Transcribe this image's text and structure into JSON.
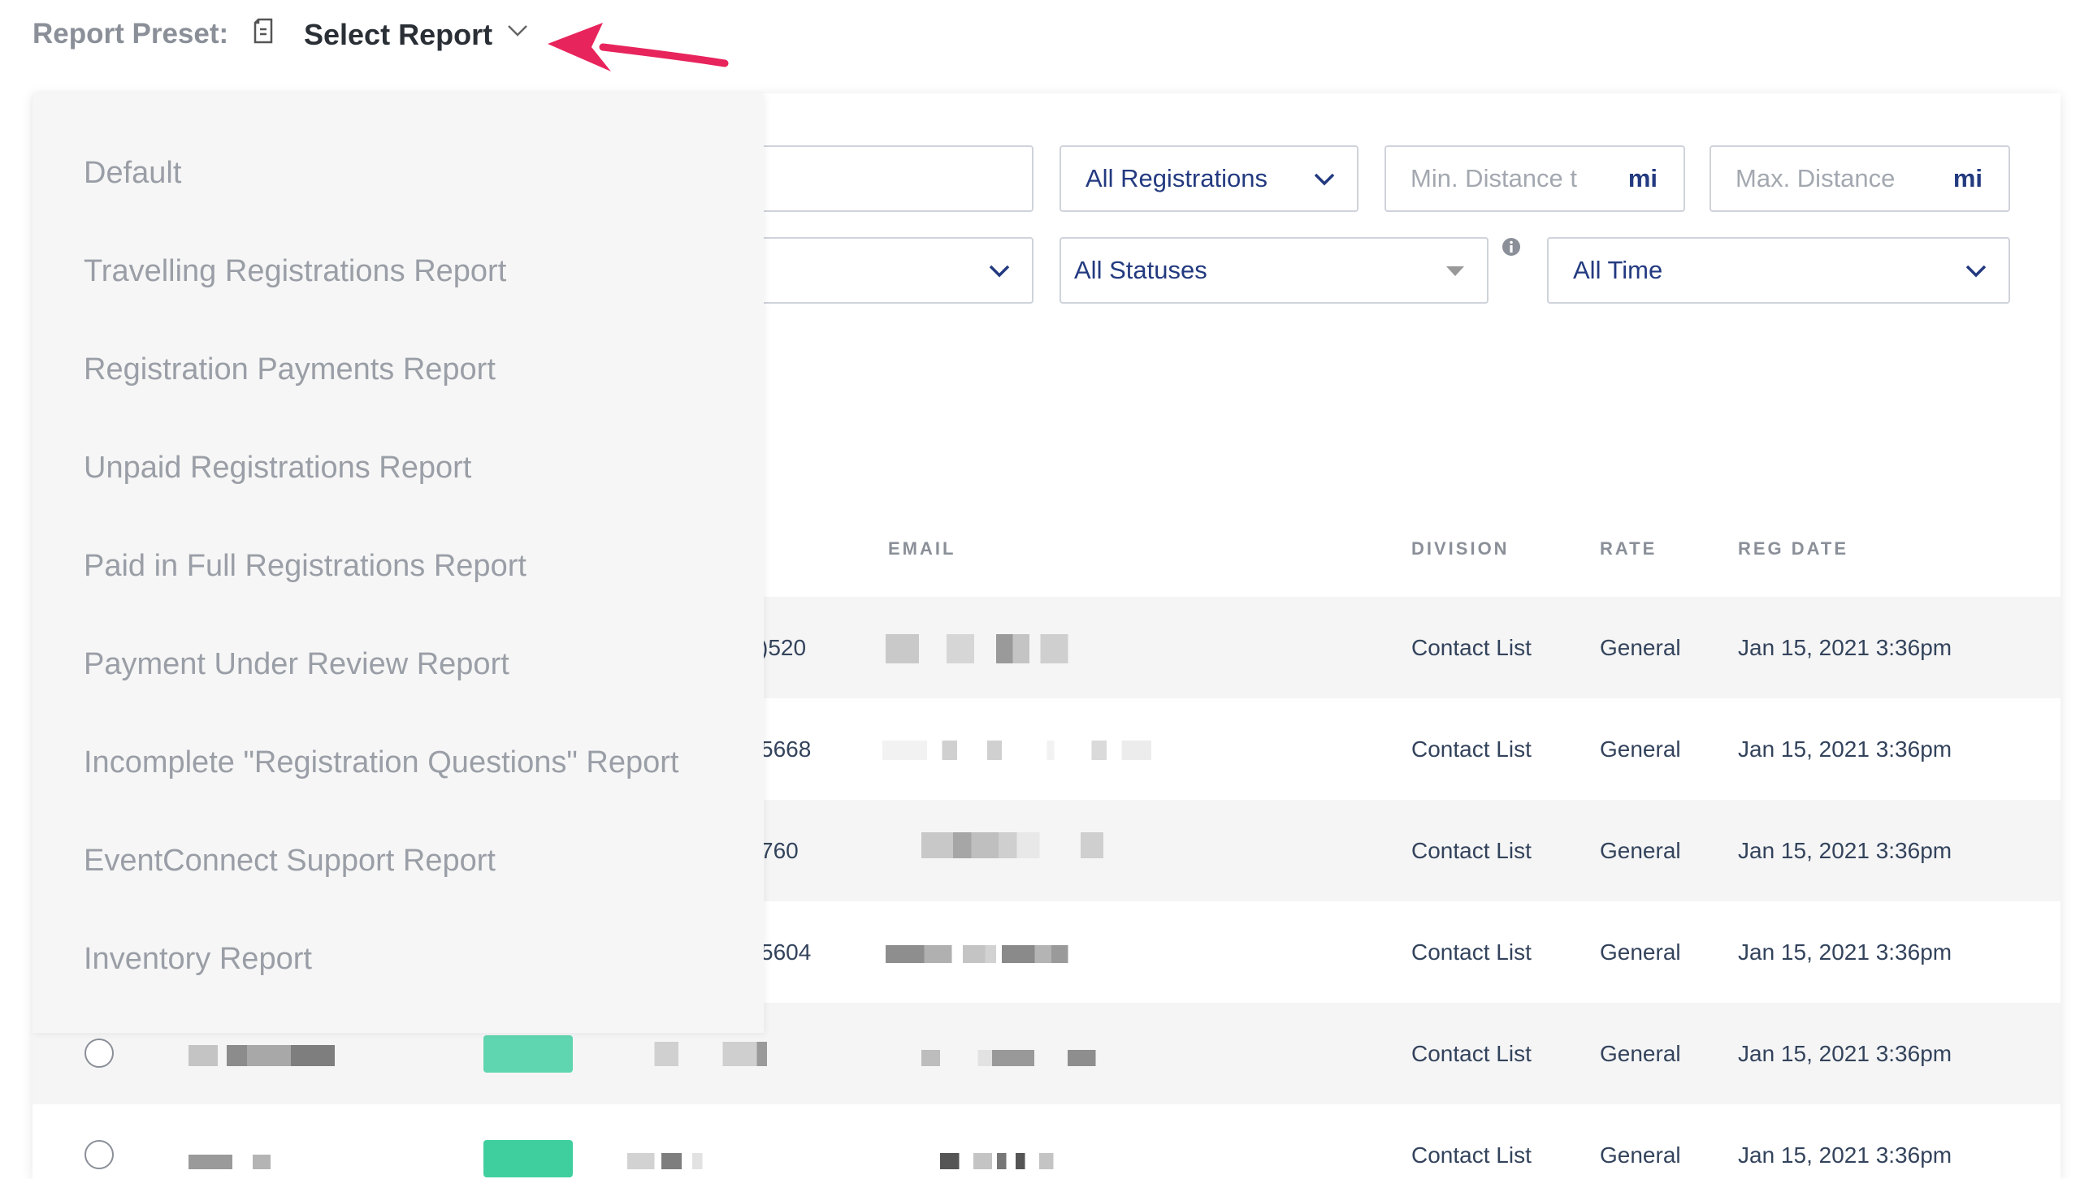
{
  "preset": {
    "label": "Report Preset:",
    "selected": "Select Report",
    "icon": "document-icon",
    "chevron": "chevron-down-icon"
  },
  "filters": {
    "registrations": "All Registrations",
    "min_distance_placeholder": "Min. Distance t",
    "max_distance_placeholder": "Max. Distance",
    "unit": "mi",
    "statuses": "All Statuses",
    "time": "All Time"
  },
  "menu": {
    "items": [
      "Default",
      "Travelling Registrations Report",
      "Registration Payments Report",
      "Unpaid Registrations Report",
      "Paid in Full Registrations Report",
      "Payment Under Review Report",
      "Incomplete \"Registration Questions\" Report",
      "EventConnect Support Report",
      "Inventory Report"
    ]
  },
  "table": {
    "headers": {
      "email": "EMAIL",
      "division": "DIVISION",
      "rate": "RATE",
      "reg_date": "REG DATE"
    },
    "rows": [
      {
        "id_tail": ")520",
        "division": "Contact List",
        "rate": "General",
        "reg_date": "Jan 15, 2021 3:36pm"
      },
      {
        "id_tail": "5668",
        "division": "Contact List",
        "rate": "General",
        "reg_date": "Jan 15, 2021 3:36pm"
      },
      {
        "id_tail": "760",
        "division": "Contact List",
        "rate": "General",
        "reg_date": "Jan 15, 2021 3:36pm"
      },
      {
        "id_tail": "5604",
        "division": "Contact List",
        "rate": "General",
        "reg_date": "Jan 15, 2021 3:36pm"
      },
      {
        "id_tail": "",
        "division": "Contact List",
        "rate": "General",
        "reg_date": "Jan 15, 2021 3:36pm"
      },
      {
        "id_tail": "",
        "division": "Contact List",
        "rate": "General",
        "reg_date": "Jan 15, 2021 3:36pm"
      }
    ]
  },
  "colors": {
    "accent_arrow": "#e8245c",
    "unit_text": "#233a80",
    "pill": "#4fd1a6"
  }
}
